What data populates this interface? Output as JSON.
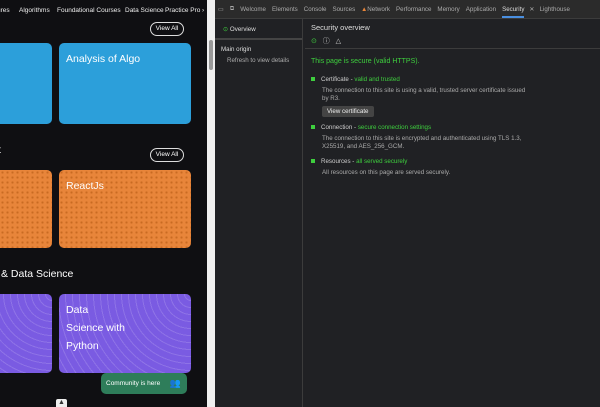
{
  "page": {
    "nav": [
      "ures",
      "Algorithms",
      "Foundational Courses",
      "Data Science",
      "Practice Pro"
    ],
    "view_all": "View All",
    "card_algo": "Analysis of Algo",
    "heading2": "t",
    "card_react": "ReactJs",
    "heading3": "& Data Science",
    "card_ds": "Data Science with Python",
    "community": "Community is here"
  },
  "devtools": {
    "tabs": [
      "Welcome",
      "Elements",
      "Console",
      "Sources",
      "Network",
      "Performance",
      "Memory",
      "Application",
      "Security",
      "Lighthouse"
    ],
    "active_tab": "Security",
    "sidebar": {
      "overview": "Overview",
      "main_origin": "Main origin",
      "refresh": "Refresh to view details"
    },
    "title": "Security overview",
    "secure_msg": "This page is secure (valid HTTPS).",
    "cert_label": "Certificate - ",
    "cert_status": "valid and trusted",
    "cert_desc": "The connection to this site is using a valid, trusted server certificate issued by R3.",
    "view_cert": "View certificate",
    "conn_label": "Connection - ",
    "conn_status": "secure connection settings",
    "conn_desc": "The connection to this site is encrypted and authenticated using TLS 1.3, X25519, and AES_256_GCM.",
    "res_label": "Resources - ",
    "res_status": "all served securely",
    "res_desc": "All resources on this page are served securely."
  },
  "colors": {
    "secure": "#3ecf3e",
    "accent": "#4a8fe0"
  }
}
